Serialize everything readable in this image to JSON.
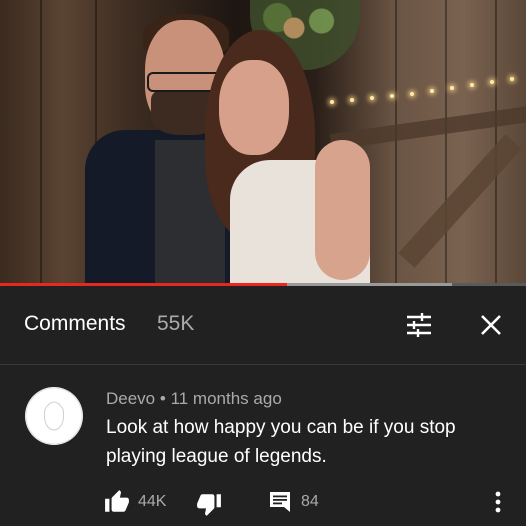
{
  "video": {
    "progress_played_fraction": 0.545,
    "progress_buffered_fraction": 0.86
  },
  "comments_panel": {
    "title": "Comments",
    "count": "55K",
    "filter_icon": "sort-filter-icon",
    "close_icon": "close-icon"
  },
  "comment": {
    "author": "Deevo",
    "separator": "•",
    "time": "11 months ago",
    "text": "Look at how happy you can be if you stop playing league of legends.",
    "likes": "44K",
    "replies": "84",
    "icons": {
      "like": "thumbs-up-icon",
      "dislike": "thumbs-down-icon",
      "reply": "reply-comment-icon",
      "more": "more-vert-icon"
    }
  },
  "colors": {
    "background": "#212121",
    "progress_played": "#e8271f",
    "secondary_text": "#aaaaaa"
  }
}
